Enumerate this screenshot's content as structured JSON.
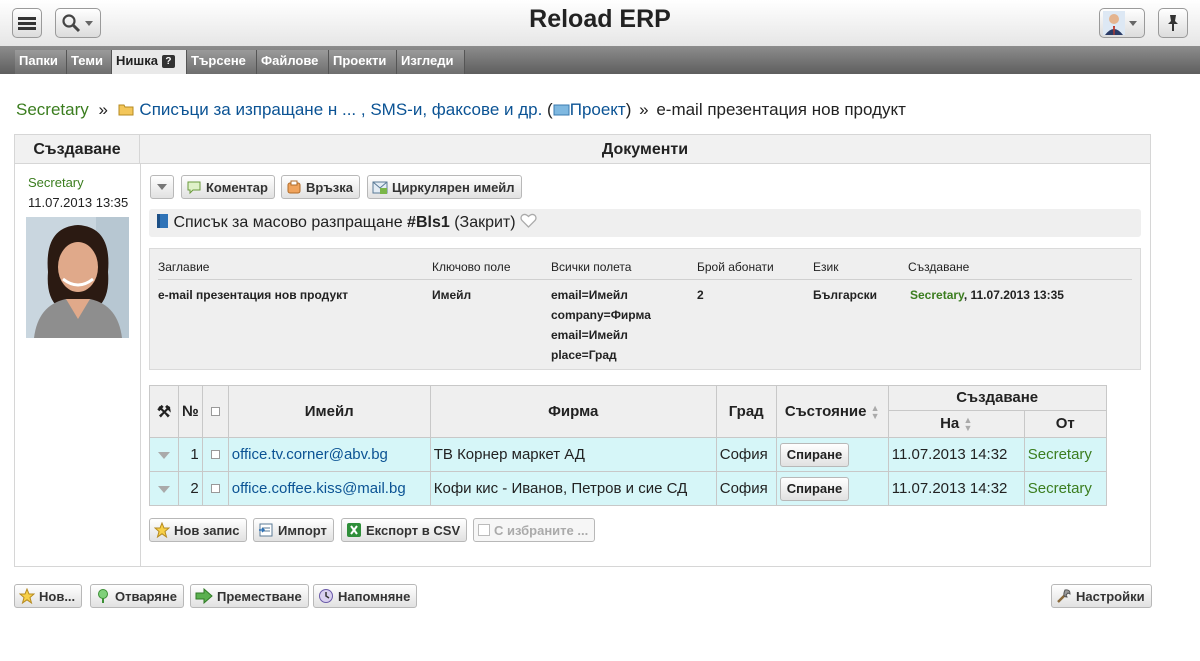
{
  "header": {
    "title": "Reload ERP",
    "menu_icon": "hamburger-menu-icon",
    "search_icon": "search-icon",
    "pin_icon": "pin-icon"
  },
  "tabs": [
    {
      "label": "Папки"
    },
    {
      "label": "Теми"
    },
    {
      "label": "Нишка",
      "badge": "?"
    },
    {
      "label": "Търсене"
    },
    {
      "label": "Файлове"
    },
    {
      "label": "Проекти"
    },
    {
      "label": "Изгледи"
    }
  ],
  "breadcrumb": {
    "user": "Secretary",
    "sep1": "»",
    "folder": "Списъци за изпращане н ... , SMS-и, факсове и др.",
    "paren_open": "(",
    "project": "Проект",
    "paren_close": ")",
    "sep2": "»",
    "current": "e-mail презентация нов продукт"
  },
  "left": {
    "heading": "Създаване",
    "author": "Secretary",
    "date": "11.07.2013 13:35"
  },
  "documents": {
    "heading": "Документи",
    "toolbar": {
      "comment": "Коментар",
      "link": "Връзка",
      "circular": "Циркулярен имейл"
    },
    "title_prefix": "Списък за масово разпращане",
    "title_id": "#Bls1",
    "title_status": "(Закрит)"
  },
  "info": {
    "labels": {
      "title": "Заглавие",
      "key_field": "Ключово поле",
      "all_fields": "Всички полета",
      "subscribers": "Брой абонати",
      "language": "Език",
      "created": "Създаване"
    },
    "values": {
      "title": "e-mail презентация нов продукт",
      "key_field": "Имейл",
      "all_fields": [
        "email=Имейл",
        "company=Фирма",
        "email=Имейл",
        "place=Град"
      ],
      "subscribers": "2",
      "language": "Български",
      "created_by": "Secretary",
      "created_at": ", 11.07.2013 13:35"
    }
  },
  "table": {
    "headers": {
      "tools": "⚒",
      "num": "№",
      "email": "Имейл",
      "company": "Фирма",
      "city": "Град",
      "status": "Състояние",
      "created": "Създаване",
      "on": "На",
      "by": "От"
    },
    "rows": [
      {
        "num": "1",
        "email": "office.tv.corner@abv.bg",
        "company": "ТВ Корнер маркет АД",
        "city": "София",
        "action": "Спиране",
        "date": "11.07.2013 14:32",
        "by": "Secretary"
      },
      {
        "num": "2",
        "email": "office.coffee.kiss@mail.bg",
        "company": "Кофи кис - Иванов, Петров и сие СД",
        "city": "София",
        "action": "Спиране",
        "date": "11.07.2013 14:32",
        "by": "Secretary"
      }
    ]
  },
  "table_actions": {
    "new": "Нов запис",
    "import": "Импорт",
    "export": "Експорт в CSV",
    "selected": "С избраните ..."
  },
  "footer_actions": {
    "new": "Нов...",
    "open": "Отваряне",
    "move": "Преместване",
    "remind": "Напомняне",
    "settings": "Настройки"
  },
  "colors": {
    "link": "#0b5394",
    "user": "#3b7d1f",
    "row_bg": "#d6f6f8"
  }
}
